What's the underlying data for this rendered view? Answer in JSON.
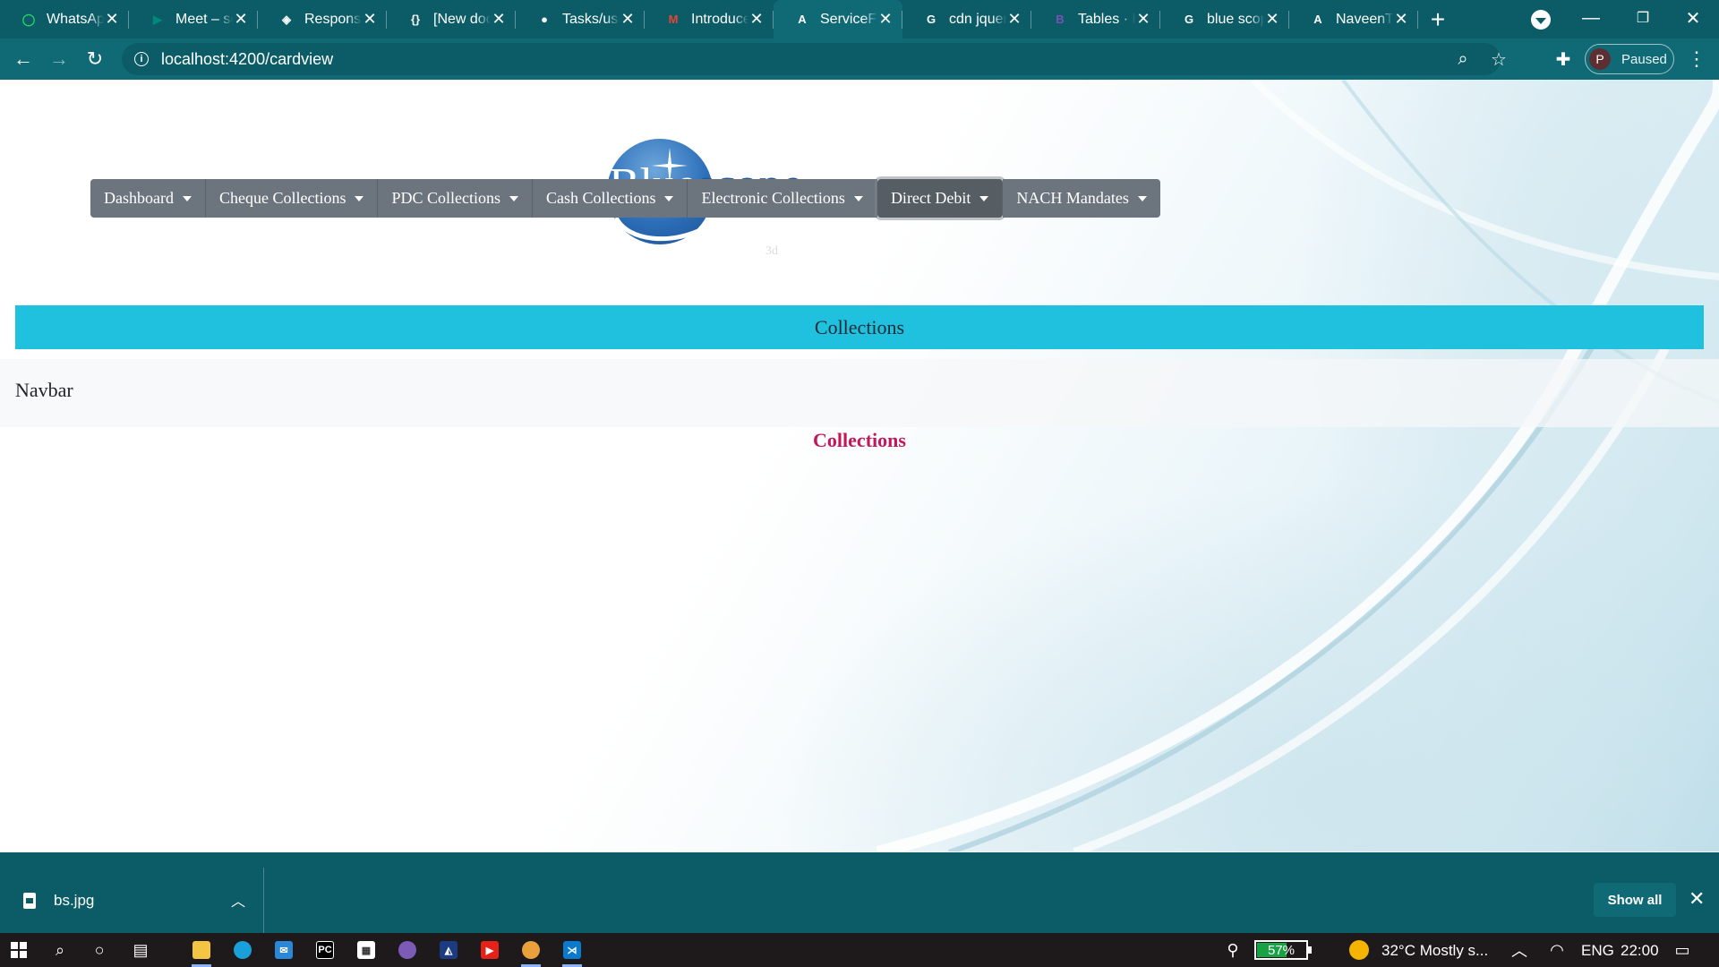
{
  "browser": {
    "tabs": [
      {
        "title": "WhatsApp",
        "favicon": "whatsapp-icon",
        "favicon_color": "#25d366",
        "favicon_glyph": "◯"
      },
      {
        "title": "Meet – sc",
        "favicon": "google-meet-icon",
        "favicon_color": "#00897b",
        "favicon_glyph": "▶"
      },
      {
        "title": "Responsiv",
        "favicon": "codepen-icon",
        "favicon_color": "#ffffff",
        "favicon_glyph": "◈"
      },
      {
        "title": "[New doc",
        "favicon": "json-braces-icon",
        "favicon_color": "#ffffff",
        "favicon_glyph": "{}"
      },
      {
        "title": "Tasks/use",
        "favicon": "github-icon",
        "favicon_color": "#ffffff",
        "favicon_glyph": "●"
      },
      {
        "title": "Introduce",
        "favicon": "gmail-icon",
        "favicon_color": "#ea4335",
        "favicon_glyph": "M"
      },
      {
        "title": "ServiceFo",
        "favicon": "angular-icon",
        "favicon_color": "#ffffff",
        "favicon_glyph": "A",
        "active": true
      },
      {
        "title": "cdn jquer",
        "favicon": "google-icon",
        "favicon_color": "#ffffff",
        "favicon_glyph": "G"
      },
      {
        "title": "Tables · B",
        "favicon": "bootstrap-icon",
        "favicon_color": "#7952b3",
        "favicon_glyph": "B"
      },
      {
        "title": "blue scop",
        "favicon": "google-icon",
        "favicon_color": "#ffffff",
        "favicon_glyph": "G"
      },
      {
        "title": "NaveenTa",
        "favicon": "angular-icon",
        "favicon_color": "#ffffff",
        "favicon_glyph": "A"
      }
    ],
    "url": "localhost:4200/cardview",
    "profile": {
      "initial": "P",
      "status": "Paused"
    }
  },
  "page": {
    "logo": {
      "part1": "Blue",
      "part2": "scope",
      "sub": "3d"
    },
    "banner": "Collections",
    "brand": "Navbar",
    "menu": [
      {
        "label": "Dashboard"
      },
      {
        "label": "Cheque Collections"
      },
      {
        "label": "PDC Collections"
      },
      {
        "label": "Cash Collections"
      },
      {
        "label": "Electronic Collections"
      },
      {
        "label": "Direct Debit",
        "active": true
      },
      {
        "label": "NACH Mandates"
      }
    ],
    "heading": "Collections",
    "heading_color": "#c2185b",
    "banner_color": "#1fc1de"
  },
  "downloads": {
    "file": "bs.jpg",
    "show_all": "Show all"
  },
  "taskbar": {
    "battery_percent": 57,
    "battery_label": "57%",
    "weather": "32°C  Mostly s...",
    "language": "ENG",
    "time": "22:00"
  }
}
